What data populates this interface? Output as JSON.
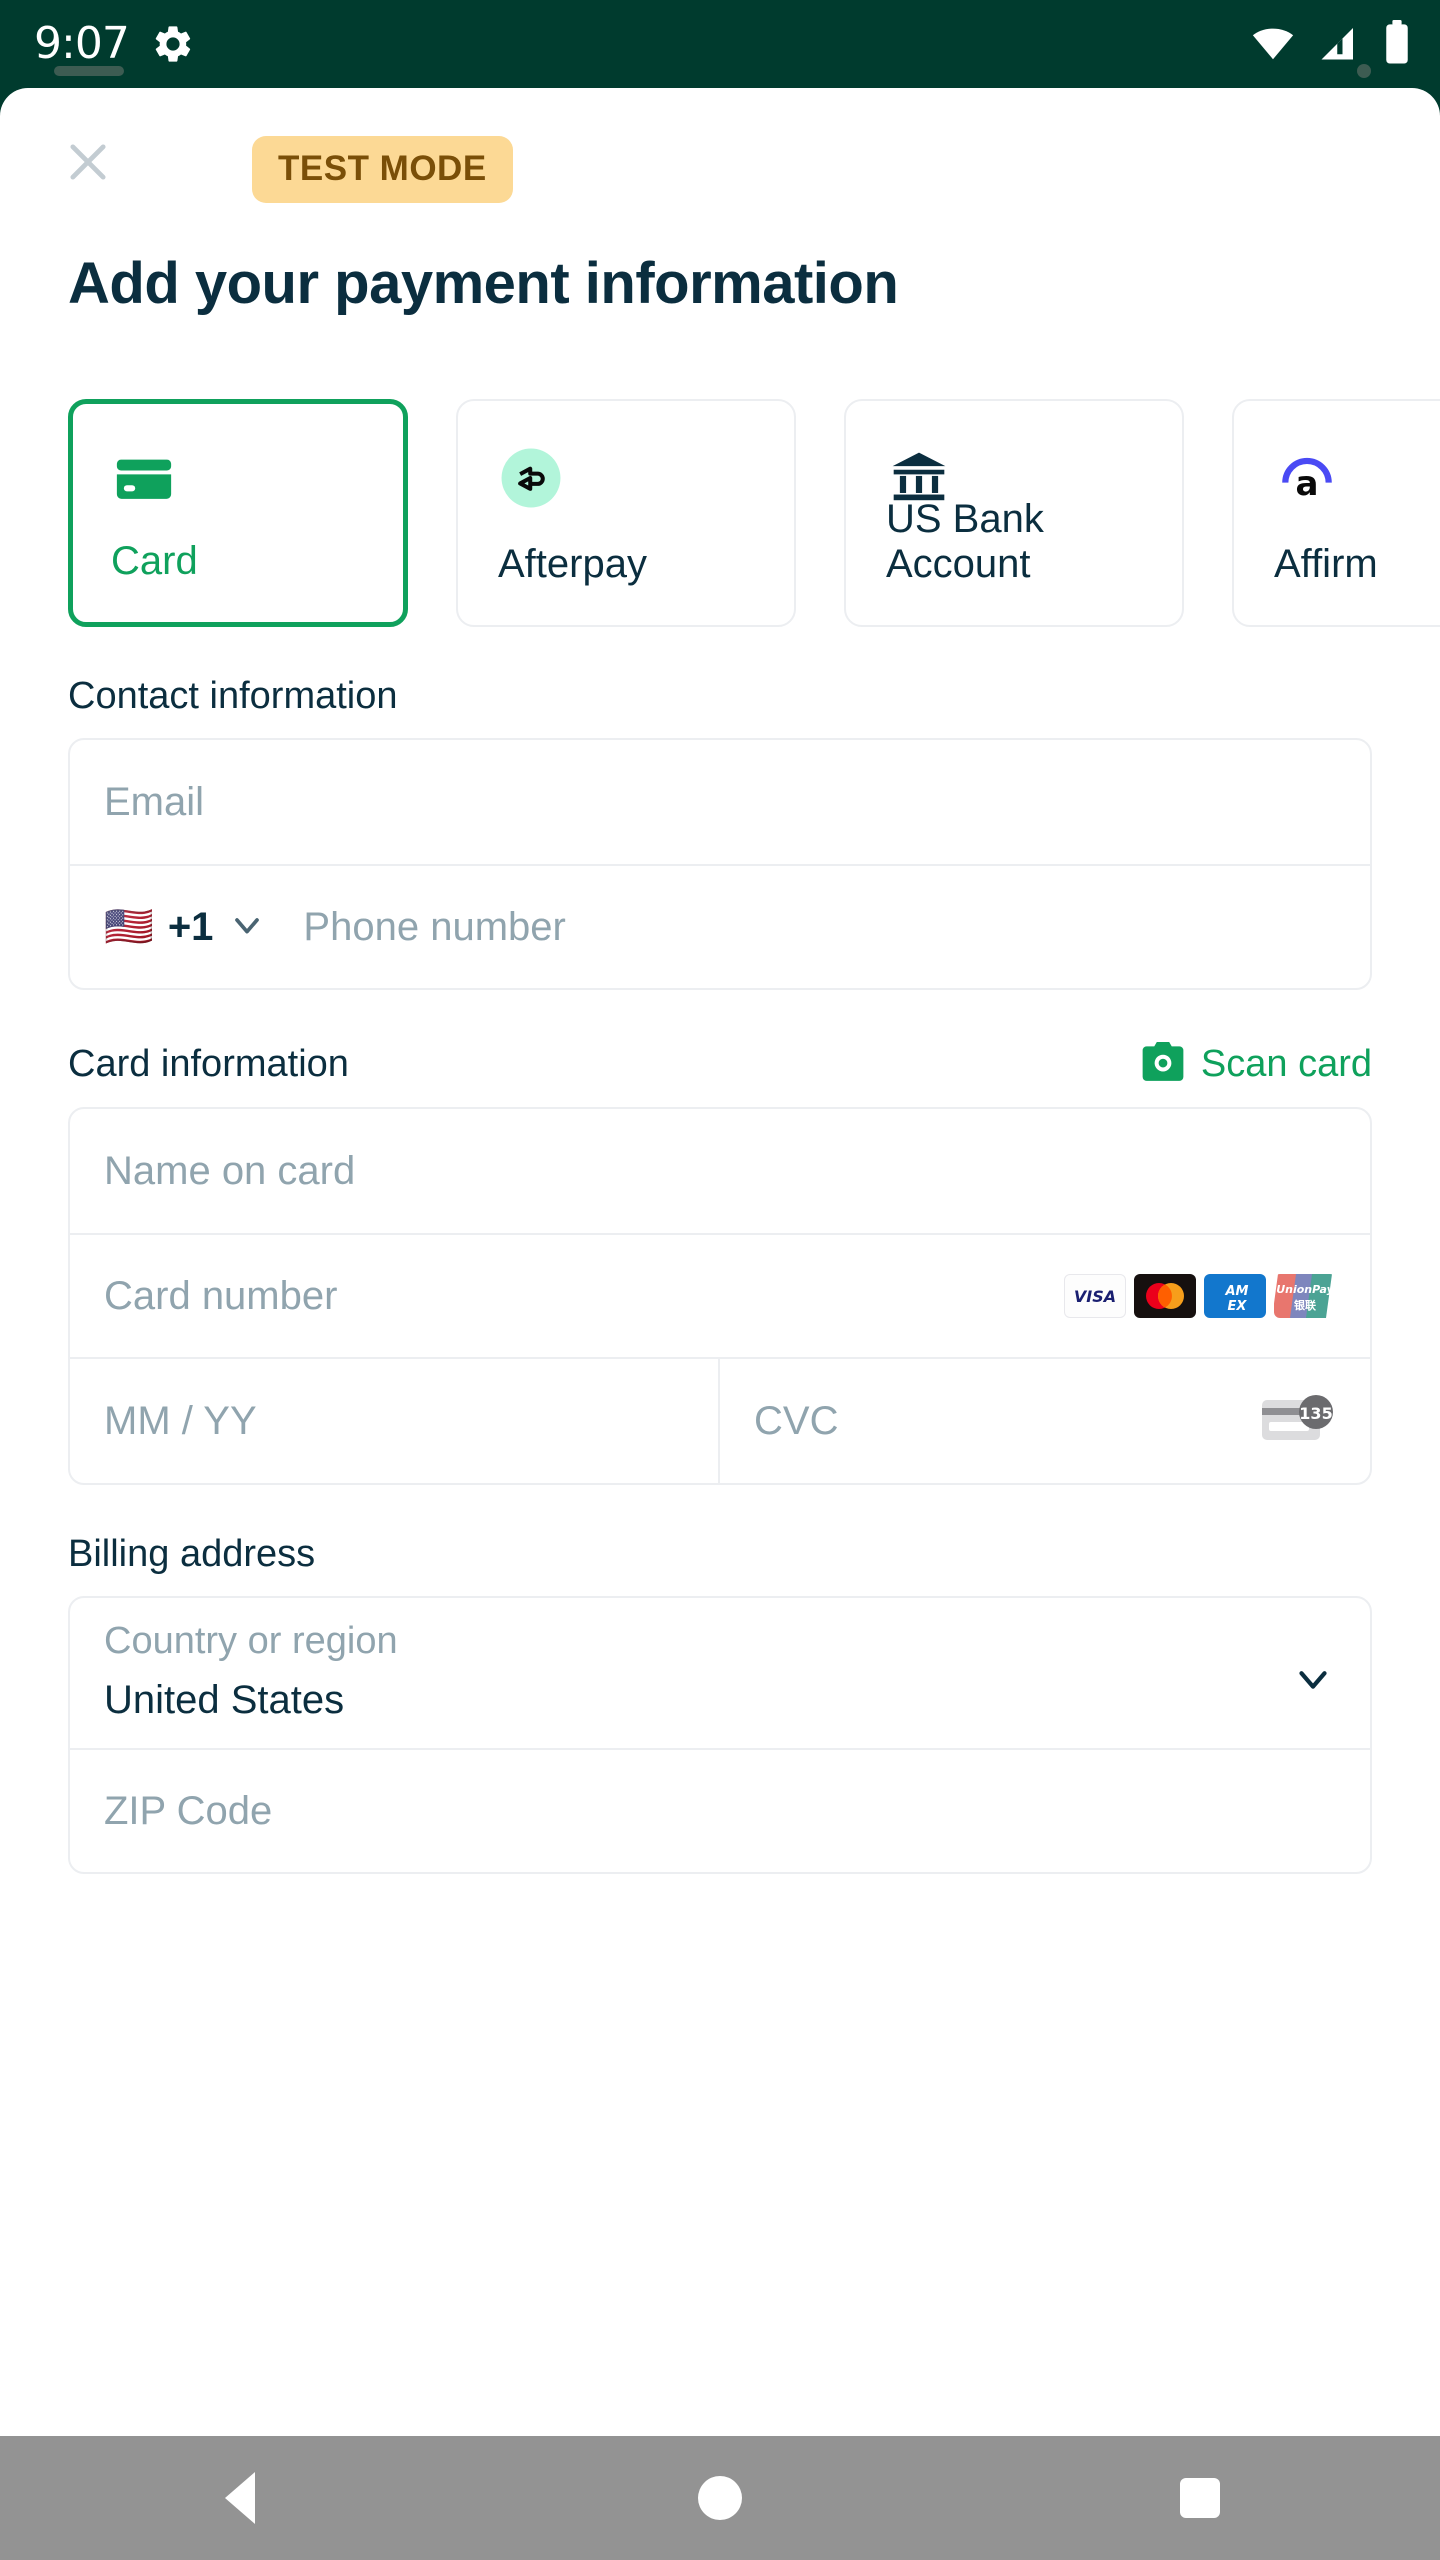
{
  "status_bar": {
    "time": "9:07",
    "icons": [
      "gear-icon",
      "wifi-icon",
      "cellular-signal-icon",
      "battery-icon"
    ],
    "background_color": "#003b2e"
  },
  "header": {
    "close_icon": "close-icon",
    "badge_label": "TEST MODE",
    "badge_bg": "#fcd995",
    "badge_fg": "#7a4f08",
    "title": "Add your payment information"
  },
  "payment_methods": {
    "selected_index": 0,
    "accent_color": "#0fa15c",
    "items": [
      {
        "label": "Card",
        "icon": "credit-card-icon"
      },
      {
        "label": "Afterpay",
        "icon": "afterpay-logo-icon"
      },
      {
        "label": "US Bank Account",
        "icon": "bank-icon"
      },
      {
        "label": "Affirm",
        "icon": "affirm-logo-icon"
      }
    ]
  },
  "contact": {
    "heading": "Contact information",
    "email_placeholder": "Email",
    "phone": {
      "flag": "🇺🇸",
      "country_code": "+1",
      "chevron_icon": "chevron-down-icon",
      "placeholder": "Phone number"
    }
  },
  "card": {
    "heading": "Card information",
    "scan_label": "Scan card",
    "scan_icon": "camera-icon",
    "scan_color": "#0fa15c",
    "name_placeholder": "Name on card",
    "number_placeholder": "Card number",
    "brands": [
      "VISA",
      "Mastercard",
      "AMEX",
      "UnionPay"
    ],
    "brand_visa_text": "VISA",
    "brand_amex_line1": "AM",
    "brand_amex_line2": "EX",
    "brand_up_text": "UnionPay",
    "brand_up_sub": "银联",
    "expiry_placeholder": "MM / YY",
    "cvc_placeholder": "CVC",
    "cvc_icon": "card-back-cvc-icon",
    "cvc_badge_number": "135"
  },
  "billing": {
    "heading": "Billing address",
    "country_label": "Country or region",
    "country_value": "United States",
    "chevron_icon": "chevron-down-icon",
    "zip_placeholder": "ZIP Code"
  },
  "nav_bar": {
    "back_icon": "triangle-back-icon",
    "home_icon": "circle-home-icon",
    "recents_icon": "square-recents-icon"
  }
}
